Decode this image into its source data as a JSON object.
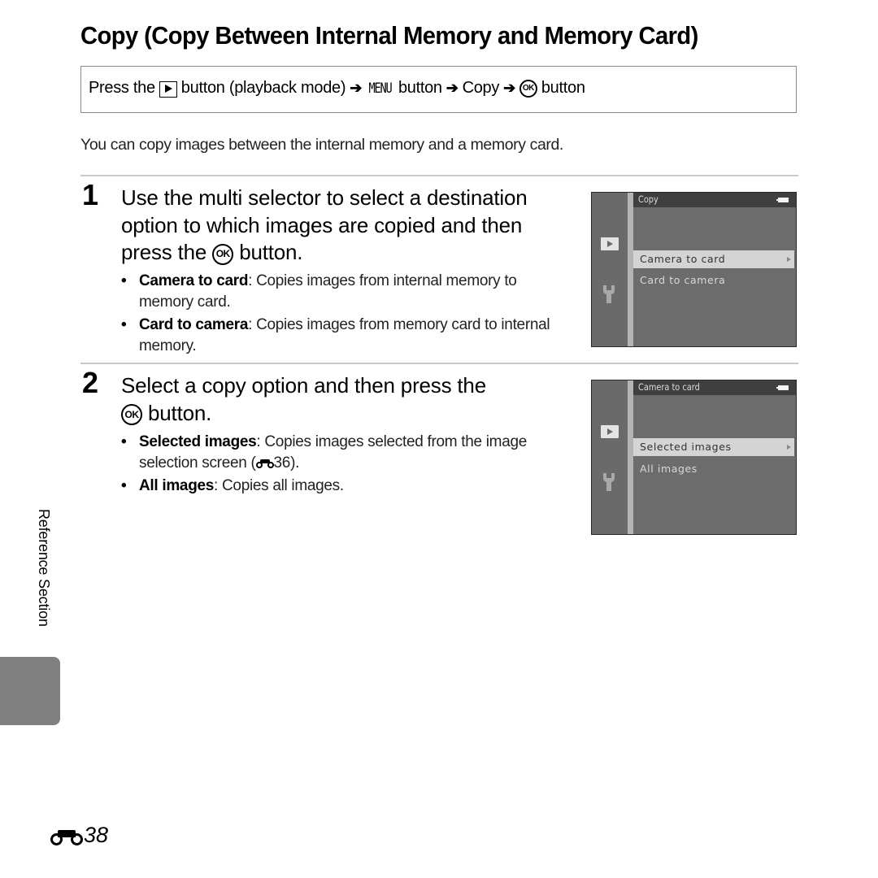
{
  "page": {
    "title": "Copy (Copy Between Internal Memory and Memory Card)",
    "nav": {
      "press_the": "Press the",
      "play_button_icon": "playback-button-icon",
      "button_playback": "button (playback mode)",
      "arrow": "➔",
      "menu_label": "MENU",
      "button": "button",
      "copy": "Copy",
      "ok_label": "OK"
    },
    "intro": "You can copy images between the internal memory and a memory card.",
    "steps": [
      {
        "number": "1",
        "text_line1": "Use the multi selector to select a destination",
        "text_line2": "option to which images are copied and then",
        "text_pre_ok": "press the",
        "text_post_ok": "button.",
        "bullets": [
          {
            "term": "Camera to card",
            "desc": ": Copies images from internal memory to memory card."
          },
          {
            "term": "Card to camera",
            "desc": ": Copies images from memory card to internal memory."
          }
        ],
        "screen": {
          "title": "Copy",
          "items": [
            {
              "label": "Camera to card",
              "selected": true
            },
            {
              "label": "Card to camera",
              "selected": false
            }
          ]
        }
      },
      {
        "number": "2",
        "text_line1": "Select a copy option and then press the",
        "text_post_ok": "button.",
        "bullets": [
          {
            "term": "Selected images",
            "desc_pre": ": Copies images selected from the image selection screen (",
            "ref": "36",
            "desc_post": ")."
          },
          {
            "term": "All images",
            "desc": ": Copies all images."
          }
        ],
        "screen": {
          "title": "Camera to card",
          "items": [
            {
              "label": "Selected images",
              "selected": true
            },
            {
              "label": "All images",
              "selected": false
            }
          ]
        }
      }
    ],
    "side_label": "Reference Section",
    "page_number": "38",
    "colors": {
      "side_tab": "#808080",
      "screen_bg": "#6c6c6c",
      "screen_header": "#3f3f3f",
      "selected_row": "#d4d4d4"
    }
  }
}
